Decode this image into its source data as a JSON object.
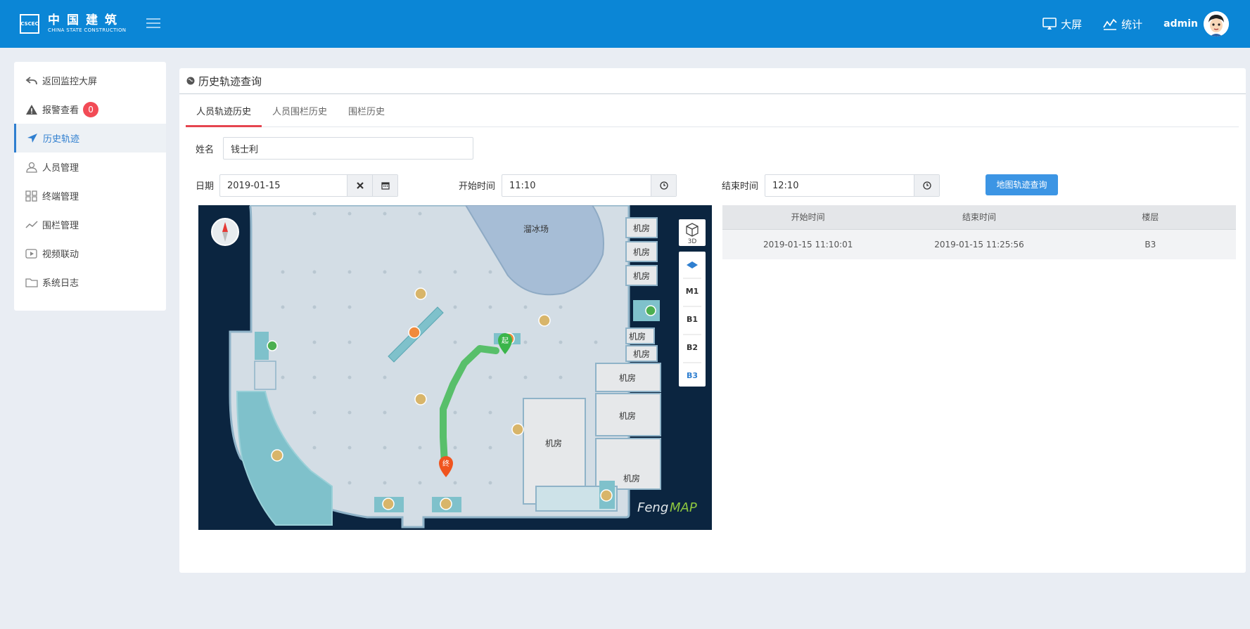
{
  "header": {
    "logo_mark": "CSCEC",
    "logo_cn": "中国建筑",
    "logo_en": "CHINA STATE CONSTRUCTION",
    "links": [
      {
        "label": "大屏",
        "icon": "monitor-icon"
      },
      {
        "label": "统计",
        "icon": "stats-icon"
      }
    ],
    "user": "admin"
  },
  "sidebar": {
    "items": [
      {
        "label": "返回监控大屏",
        "icon": "back-icon"
      },
      {
        "label": "报警查看",
        "icon": "warning-icon",
        "badge": "0"
      },
      {
        "label": "历史轨迹",
        "icon": "location-arrow-icon",
        "active": true
      },
      {
        "label": "人员管理",
        "icon": "user-icon"
      },
      {
        "label": "终端管理",
        "icon": "grid-icon"
      },
      {
        "label": "围栏管理",
        "icon": "line-chart-icon"
      },
      {
        "label": "视频联动",
        "icon": "video-icon"
      },
      {
        "label": "系统日志",
        "icon": "folder-icon"
      }
    ]
  },
  "panel": {
    "title": "历史轨迹查询",
    "tabs": [
      "人员轨迹历史",
      "人员围栏历史",
      "围栏历史"
    ],
    "form": {
      "name_label": "姓名",
      "name_value": "钱士利",
      "date_label": "日期",
      "date_value": "2019-01-15",
      "start_label": "开始时间",
      "start_value": "11:10",
      "end_label": "结束时间",
      "end_value": "12:10",
      "query_button": "地图轨迹查询"
    }
  },
  "map": {
    "ice_rink": "溜冰场",
    "room": "机房",
    "start_marker": "起",
    "end_marker": "终",
    "brand_a": "Feng",
    "brand_b": "MAP",
    "view_3d": "3D",
    "floors": [
      "M1",
      "B1",
      "B2",
      "B3"
    ],
    "active_floor": "B3"
  },
  "table": {
    "headers": [
      "开始时间",
      "结束时间",
      "楼层"
    ],
    "rows": [
      [
        "2019-01-15 11:10:01",
        "2019-01-15 11:25:56",
        "B3"
      ]
    ]
  }
}
